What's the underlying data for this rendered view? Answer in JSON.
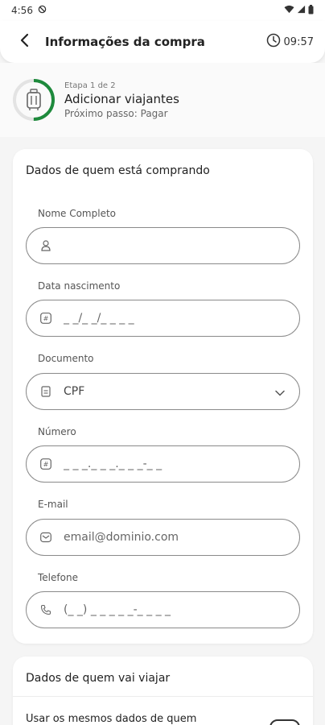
{
  "statusbar": {
    "time": "4:56"
  },
  "header": {
    "title": "Informações da compra",
    "timer": "09:57"
  },
  "progress": {
    "step_count": "Etapa 1 de 2",
    "step_title": "Adicionar viajantes",
    "next_step": "Próximo passo: Pagar",
    "fraction": 0.5,
    "accent": "#1e8a3c"
  },
  "buyer": {
    "title": "Dados de quem está comprando",
    "fields": {
      "name": {
        "label": "Nome Completo",
        "placeholder": ""
      },
      "birth": {
        "label": "Data nascimento",
        "placeholder": "_ _/_ _/_ _ _ _"
      },
      "document": {
        "label": "Documento",
        "value": "CPF"
      },
      "number": {
        "label": "Número",
        "placeholder": "_ _ _._ _ _._ _ _-_ _"
      },
      "email": {
        "label": "E-mail",
        "placeholder": "email@dominio.com"
      },
      "phone": {
        "label": "Telefone",
        "placeholder": "(_ _) _ _ _ _ _-_ _ _ _"
      }
    }
  },
  "traveler": {
    "title": "Dados de quem vai viajar",
    "same_data_label": "Usar os mesmos dados de quem"
  }
}
